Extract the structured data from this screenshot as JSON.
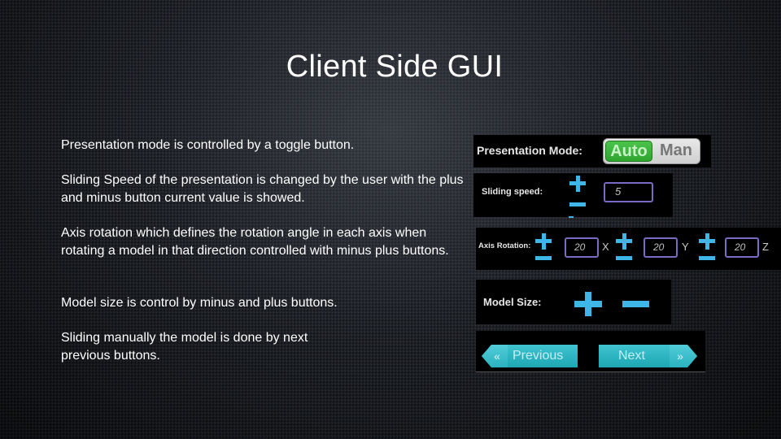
{
  "title": "Client Side GUI",
  "descriptions": {
    "presentation_mode": "Presentation mode is controlled by a toggle button.",
    "sliding_speed": "Sliding Speed of the presentation is changed by the user with the plus and minus button current value is showed.",
    "axis_rotation": "Axis rotation which defines the rotation angle in each axis when rotating a model in that direction controlled with minus plus buttons.",
    "model_size": "Model size is control by minus and plus buttons.",
    "manual_sliding": "Sliding manually the model is done by next previous buttons."
  },
  "panels": {
    "presentation_mode": {
      "label": "Presentation Mode:",
      "options": [
        "Auto",
        "Man"
      ],
      "selected": "Auto"
    },
    "sliding_speed": {
      "label": "Sliding speed:",
      "value": "5"
    },
    "axis_rotation": {
      "label": "Axis Rotation:",
      "axes": [
        {
          "name": "X",
          "value": "20"
        },
        {
          "name": "Y",
          "value": "20"
        },
        {
          "name": "Z",
          "value": "20"
        }
      ]
    },
    "model_size": {
      "label": "Model Size:"
    },
    "navigation": {
      "previous_label": "Previous",
      "next_label": "Next",
      "previous_arrow": "«",
      "next_arrow": "»"
    }
  },
  "colors": {
    "toggle_active": "#3cb83c",
    "control_blue": "#3fb6e8",
    "value_border": "#7a6ac2",
    "nav_teal": "#2ab2c0"
  }
}
